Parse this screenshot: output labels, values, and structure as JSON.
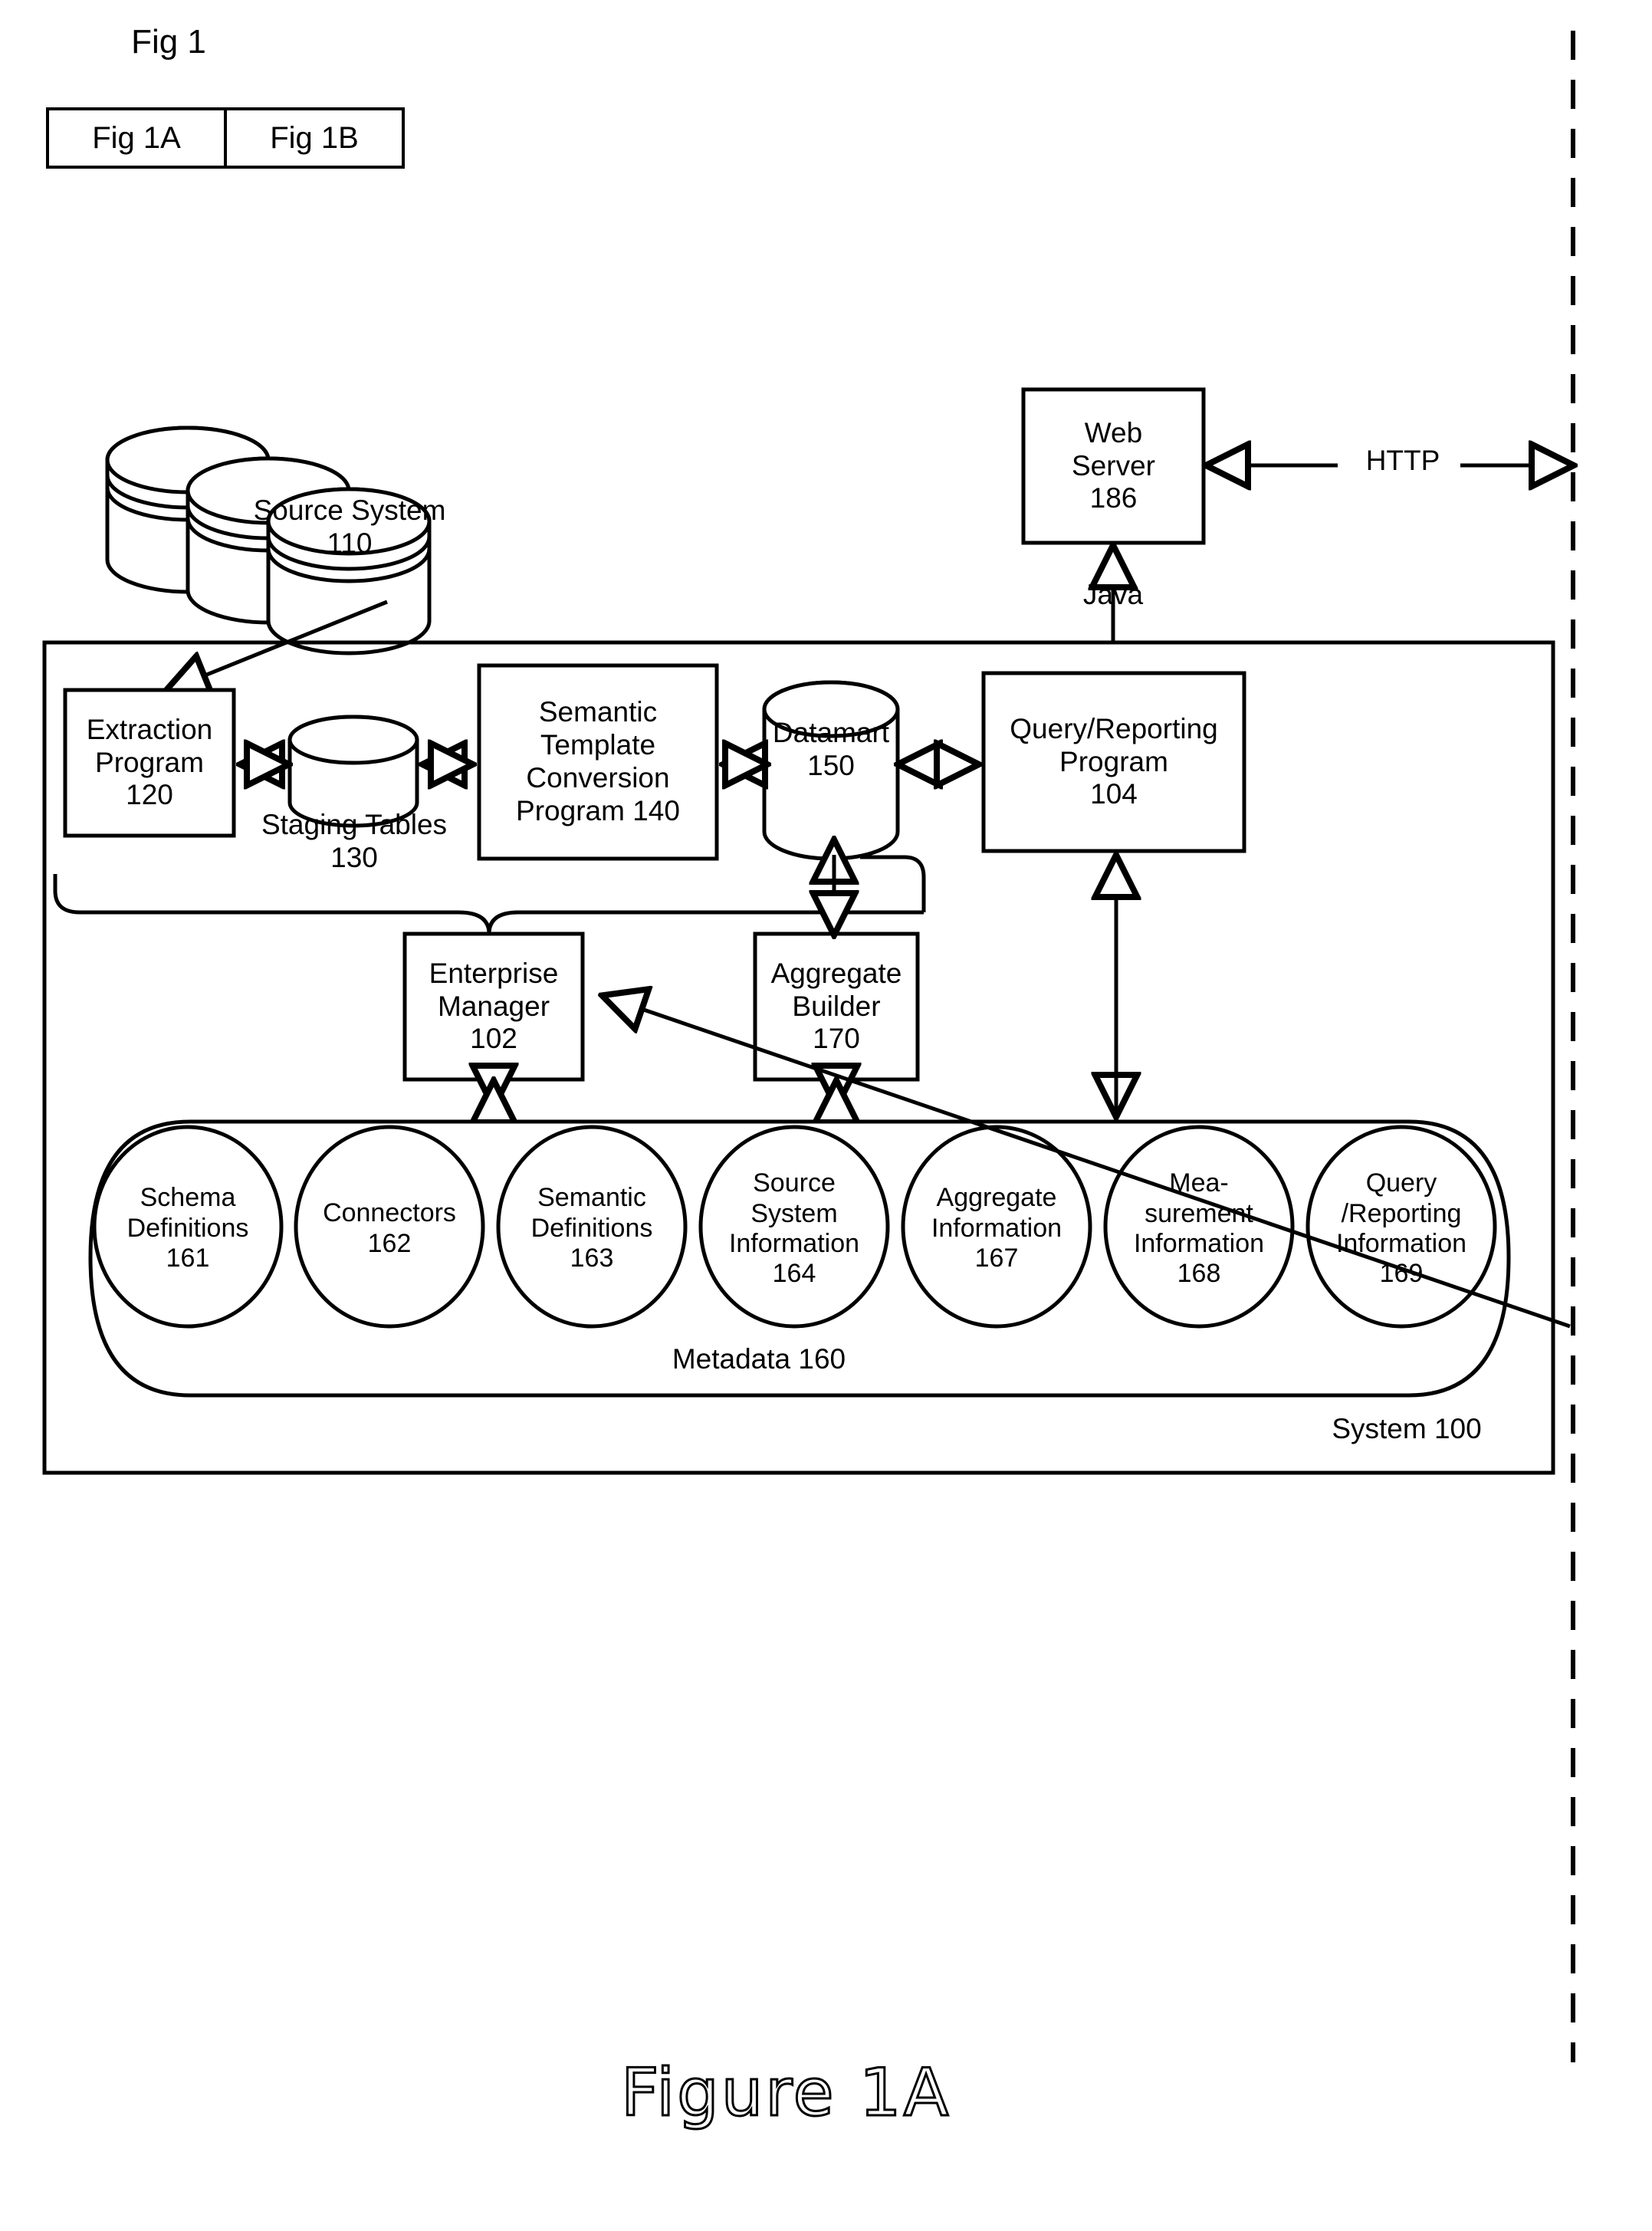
{
  "figure_key": {
    "title": "Fig 1",
    "cells": [
      {
        "label": "Fig 1A"
      },
      {
        "label": "Fig 1B"
      }
    ]
  },
  "caption": "Figure 1A",
  "diagram": {
    "source_system": {
      "name": "Source System",
      "ref": "110"
    },
    "web_server": {
      "line1": "Web",
      "line2": "Server",
      "ref": "186"
    },
    "http_label": "HTTP",
    "java_label": "Java",
    "system_label": "System 100",
    "metadata_label": "Metadata 160",
    "boxes": [
      {
        "id": "extraction",
        "line1": "Extraction",
        "line2": "Program",
        "ref": "120"
      },
      {
        "id": "semantic_template",
        "line1": "Semantic",
        "line2": "Template",
        "line3": "Conversion",
        "line4": "Program 140"
      },
      {
        "id": "query_reporting",
        "line1": "Query/Reporting",
        "line2": "Program",
        "ref": "104"
      },
      {
        "id": "enterprise_manager",
        "line1": "Enterprise",
        "line2": "Manager",
        "ref": "102"
      },
      {
        "id": "aggregate_builder",
        "line1": "Aggregate",
        "line2": "Builder",
        "ref": "170"
      }
    ],
    "cylinders": [
      {
        "id": "staging_tables",
        "line1": "Staging Tables",
        "ref": "130"
      },
      {
        "id": "datamart",
        "line1": "Datamart",
        "ref": "150"
      }
    ],
    "metadata_items": [
      {
        "lines": [
          "Schema",
          "Definitions"
        ],
        "ref": "161"
      },
      {
        "lines": [
          "Connectors"
        ],
        "ref": "162"
      },
      {
        "lines": [
          "Semantic",
          "Definitions"
        ],
        "ref": "163"
      },
      {
        "lines": [
          "Source",
          "System",
          "Information"
        ],
        "ref": "164"
      },
      {
        "lines": [
          "Aggregate",
          "Information"
        ],
        "ref": "167"
      },
      {
        "lines": [
          "Mea-",
          "surement",
          "Information"
        ],
        "ref": "168"
      },
      {
        "lines": [
          "Query",
          "/Reporting",
          "Information"
        ],
        "ref": "169"
      }
    ]
  },
  "colors": {
    "ink": "#000000",
    "paper": "#ffffff"
  }
}
